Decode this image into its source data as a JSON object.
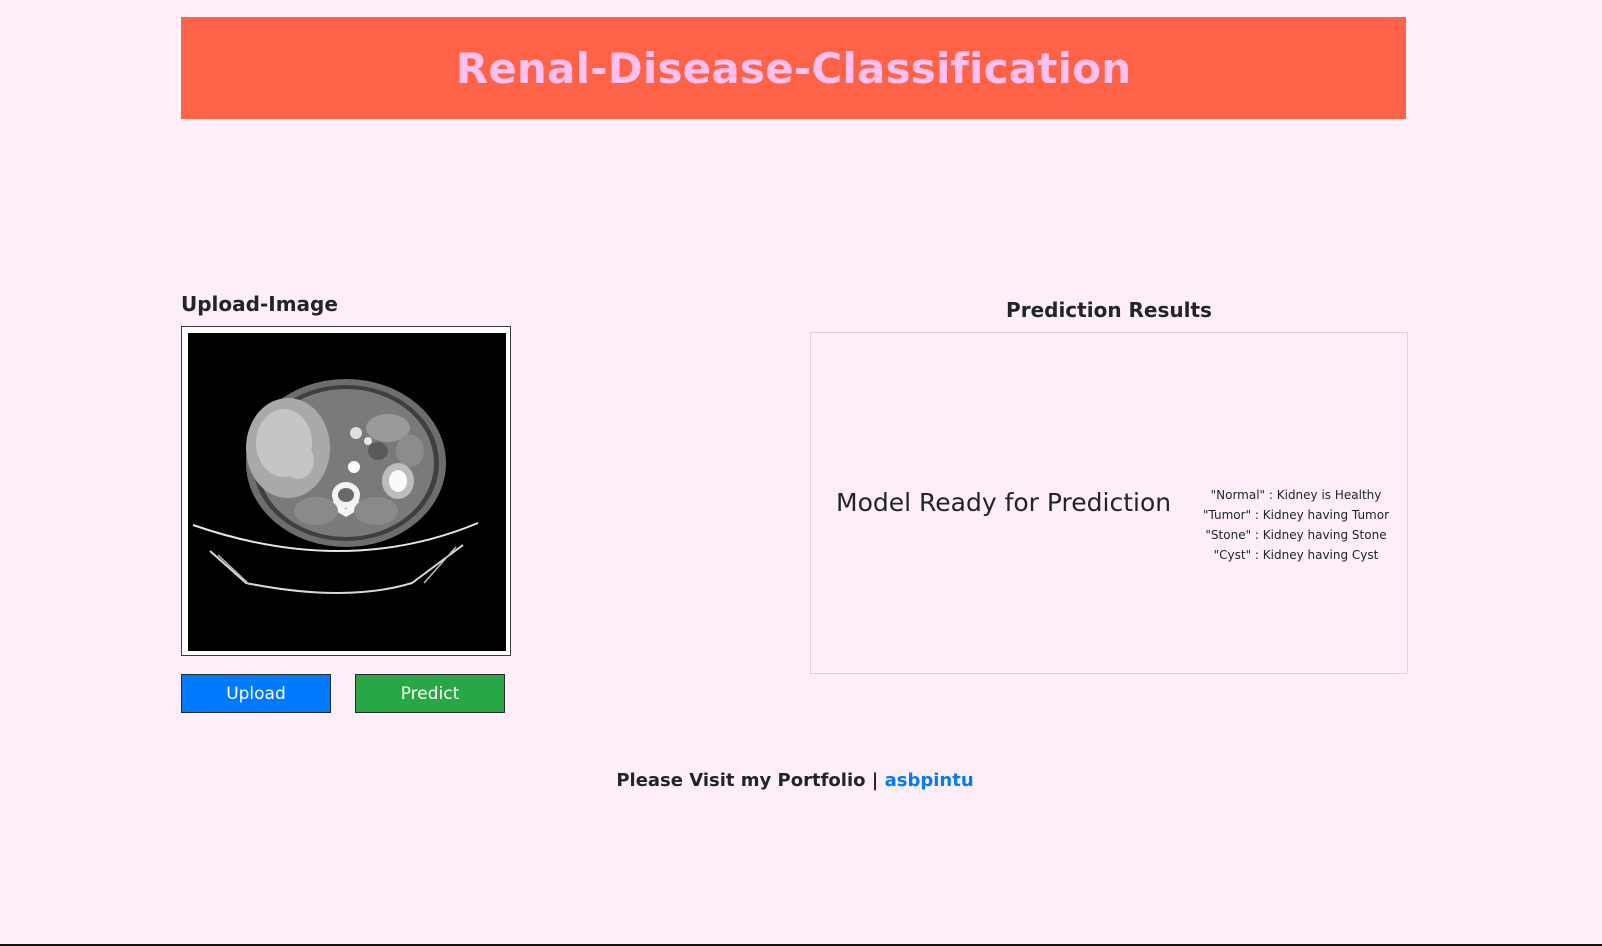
{
  "header": {
    "title": "Renal-Disease-Classification"
  },
  "upload": {
    "heading": "Upload-Image",
    "image_alt": "ct-scan-kidney-image"
  },
  "buttons": {
    "upload_label": "Upload",
    "predict_label": "Predict"
  },
  "results": {
    "heading": "Prediction Results",
    "status": "Model Ready for Prediction",
    "legend": [
      "\"Normal\" : Kidney is Healthy",
      "\"Tumor\" : Kidney having Tumor",
      "\"Stone\" : Kidney having Stone",
      "\"Cyst\" : Kidney having Cyst"
    ]
  },
  "footer": {
    "text": "Please Visit my Portfolio |",
    "link_label": "asbpintu"
  },
  "colors": {
    "background": "#fdeef9",
    "header_bg": "#ff6347",
    "header_text": "#ffc0f0",
    "upload_button": "#007bff",
    "predict_button": "#28a745",
    "link": "#007bff"
  }
}
